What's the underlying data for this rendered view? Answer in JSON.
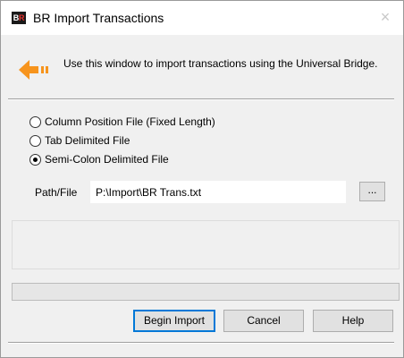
{
  "window": {
    "title": "BR Import Transactions",
    "icon_text_left": "B",
    "icon_text_right": "R",
    "close_glyph": "×"
  },
  "info": {
    "icon": "arrow-left-icon",
    "text": "Use this window to import transactions using the Universal Bridge."
  },
  "file_type": {
    "options": [
      {
        "label": "Column Position File (Fixed Length)",
        "selected": false
      },
      {
        "label": "Tab Delimited File",
        "selected": false
      },
      {
        "label": "Semi-Colon Delimited File",
        "selected": true
      }
    ]
  },
  "path": {
    "label": "Path/File",
    "value": "P:\\Import\\BR Trans.txt",
    "browse_label": "..."
  },
  "progress": {
    "fraction": 0
  },
  "buttons": {
    "begin": "Begin Import",
    "cancel": "Cancel",
    "help": "Help"
  },
  "colors": {
    "accent": "#0078d7",
    "arrow": "#f7941d"
  }
}
